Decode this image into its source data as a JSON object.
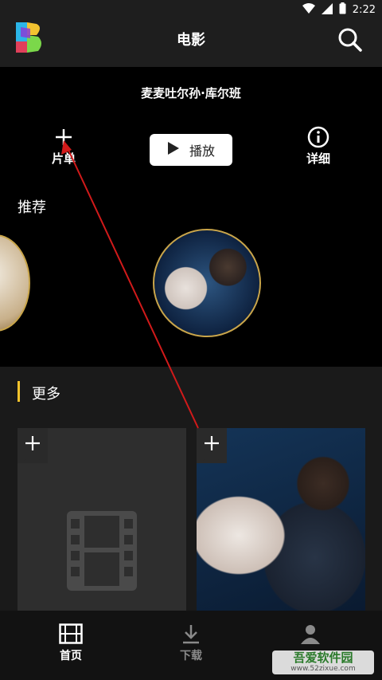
{
  "status": {
    "time": "2:22",
    "icons": [
      "wifi-icon",
      "signal-icon",
      "battery-icon"
    ]
  },
  "header": {
    "title": "电影",
    "logo": "app-logo",
    "search_icon": "search-icon"
  },
  "hero": {
    "movie_title": "麦麦吐尔孙·库尔班",
    "add_label": "片单",
    "play_label": "播放",
    "detail_label": "详细",
    "recommend_label": "推荐"
  },
  "more": {
    "label": "更多",
    "cards": [
      {
        "kind": "placeholder"
      },
      {
        "kind": "poster"
      }
    ]
  },
  "tabs": [
    {
      "label": "首页",
      "icon": "film-icon",
      "active": true
    },
    {
      "label": "下载",
      "icon": "download-icon",
      "active": false
    },
    {
      "label": "",
      "icon": "user-icon",
      "active": false
    }
  ],
  "watermark": {
    "text": "吾爱软件园",
    "sub": "www.52zixue.com"
  },
  "colors": {
    "accent": "#f5c32c",
    "annotation_arrow": "#d11a1a"
  }
}
